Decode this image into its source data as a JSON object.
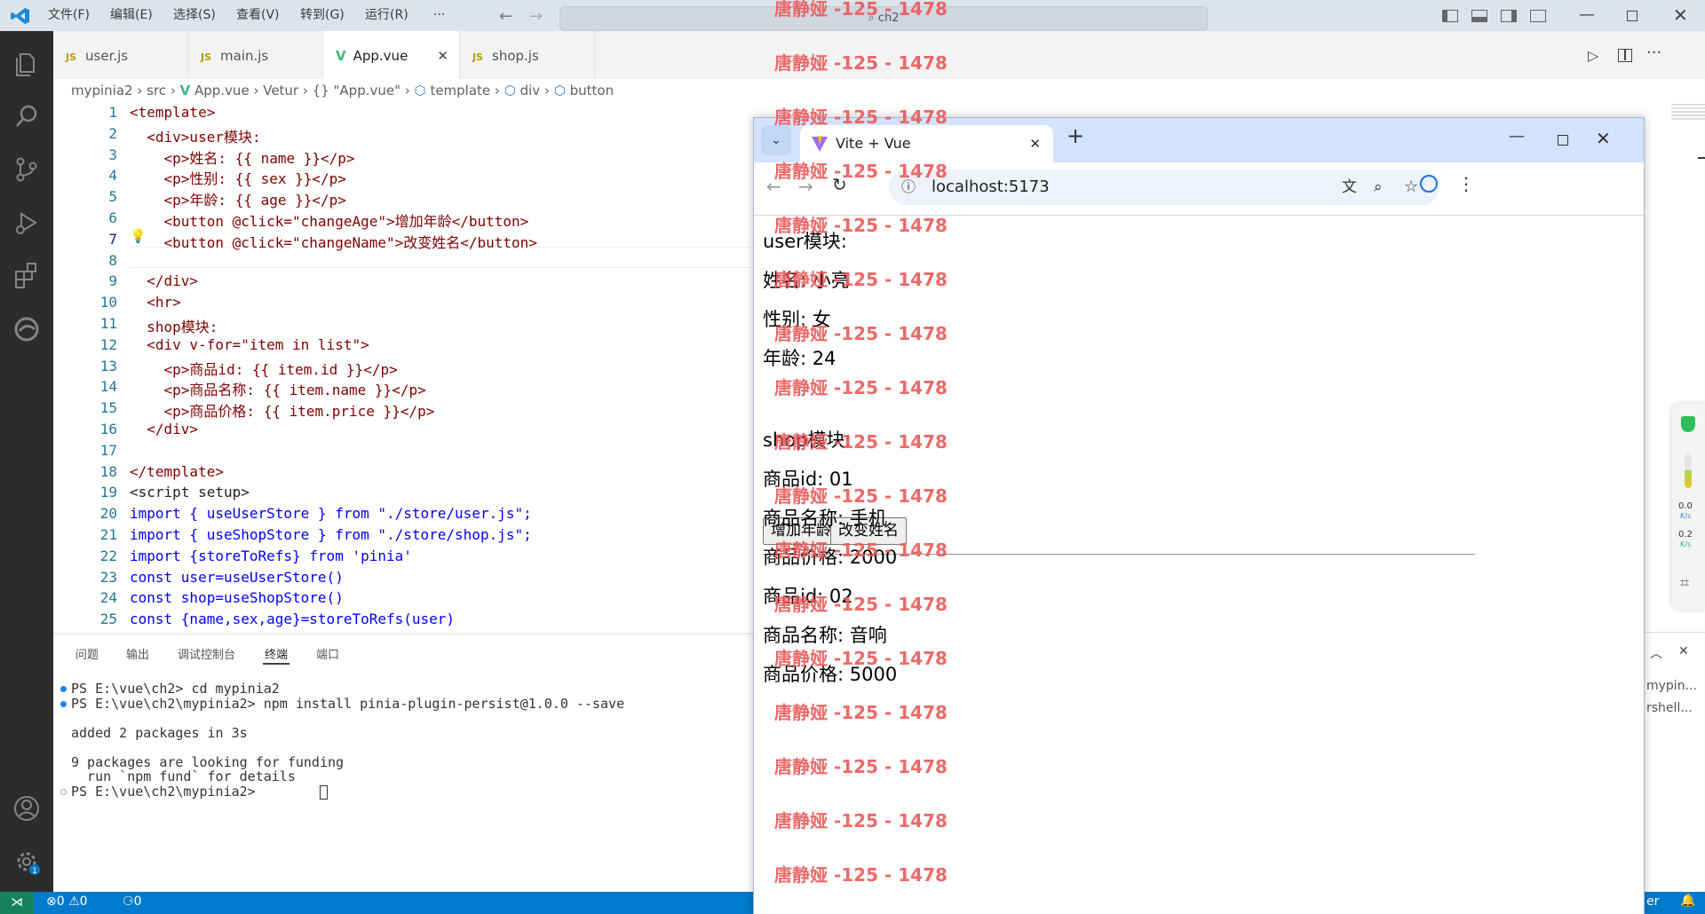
{
  "titlebar": {
    "menus": [
      "文件(F)",
      "编辑(E)",
      "选择(S)",
      "查看(V)",
      "转到(G)",
      "运行(R)",
      "···"
    ],
    "search_text": "ch2"
  },
  "tabs": [
    {
      "label": "user.js",
      "badge": "JS"
    },
    {
      "label": "main.js",
      "badge": "JS"
    },
    {
      "label": "App.vue",
      "badge": "V"
    },
    {
      "label": "shop.js",
      "badge": "JS"
    }
  ],
  "breadcrumb": [
    "mypinia2",
    "src",
    "App.vue",
    "Vetur",
    "{} \"App.vue\"",
    "template",
    "div",
    "button"
  ],
  "editor": {
    "lines": [
      {
        "n": "1",
        "text": "<template>"
      },
      {
        "n": "2",
        "text": "  <div>user模块:"
      },
      {
        "n": "3",
        "text": "    <p>姓名: {{ name }}</p>"
      },
      {
        "n": "4",
        "text": "    <p>性别: {{ sex }}</p>"
      },
      {
        "n": "5",
        "text": "    <p>年龄: {{ age }}</p>"
      },
      {
        "n": "6",
        "text": "    <button @click=\"changeAge\">增加年龄</button>"
      },
      {
        "n": "7",
        "text": "    <button @click=\"changeName\">改变姓名</button>"
      },
      {
        "n": "8",
        "text": ""
      },
      {
        "n": "9",
        "text": "  </div>"
      },
      {
        "n": "10",
        "text": "  <hr>"
      },
      {
        "n": "11",
        "text": "  shop模块:"
      },
      {
        "n": "12",
        "text": "  <div v-for=\"item in list\">"
      },
      {
        "n": "13",
        "text": "    <p>商品id: {{ item.id }}</p>"
      },
      {
        "n": "14",
        "text": "    <p>商品名称: {{ item.name }}</p>"
      },
      {
        "n": "15",
        "text": "    <p>商品价格: {{ item.price }}</p>"
      },
      {
        "n": "16",
        "text": "  </div>"
      },
      {
        "n": "17",
        "text": ""
      },
      {
        "n": "18",
        "text": "</template>"
      },
      {
        "n": "19",
        "text": "<script setup>"
      },
      {
        "n": "20",
        "text": "import { useUserStore } from \"./store/user.js\";"
      },
      {
        "n": "21",
        "text": "import { useShopStore } from \"./store/shop.js\";"
      },
      {
        "n": "22",
        "text": "import {storeToRefs} from 'pinia'"
      },
      {
        "n": "23",
        "text": "const user=useUserStore()"
      },
      {
        "n": "24",
        "text": "const shop=useShopStore()"
      },
      {
        "n": "25",
        "text": "const {name,sex,age}=storeToRefs(user)"
      }
    ]
  },
  "panel": {
    "tabs": [
      "问题",
      "输出",
      "调试控制台",
      "终端",
      "端口"
    ],
    "active_tab": "终端",
    "terminal_lines": [
      "PS E:\\vue\\ch2> cd mypinia2",
      "PS E:\\vue\\ch2\\mypinia2> npm install pinia-plugin-persist@1.0.0 --save",
      "",
      "added 2 packages in 3s",
      "",
      "9 packages are looking for funding",
      "  run `npm fund` for details",
      "PS E:\\vue\\ch2\\mypinia2> "
    ],
    "right_items": [
      "mypin...",
      "rshell..."
    ]
  },
  "statusbar": {
    "errors": "0",
    "warnings": "0",
    "ports": "0",
    "right_text": "er"
  },
  "browser": {
    "tab_title": "Vite + Vue",
    "url": "localhost:5173",
    "content": {
      "user_heading": "user模块:",
      "name_line": "姓名: 小亮",
      "sex_line": "性别: 女",
      "age_line": "年龄: 24",
      "btn_age": "增加年龄",
      "btn_name": "改变姓名",
      "shop_heading": "shop模块:",
      "items": [
        {
          "id": "商品id: 01",
          "name": "商品名称: 手机",
          "price": "商品价格: 2000"
        },
        {
          "id": "商品id: 02",
          "name": "商品名称: 音响",
          "price": "商品价格: 5000"
        }
      ]
    }
  },
  "watermark": "唐静娅 -125 - 1478",
  "widget": {
    "up": "0.0",
    "down": "0.2",
    "unit": "K/s"
  },
  "colors": {
    "accent": "#007acc",
    "watermark": "#ec5959",
    "browser_tabstrip": "#d3e3fd"
  }
}
